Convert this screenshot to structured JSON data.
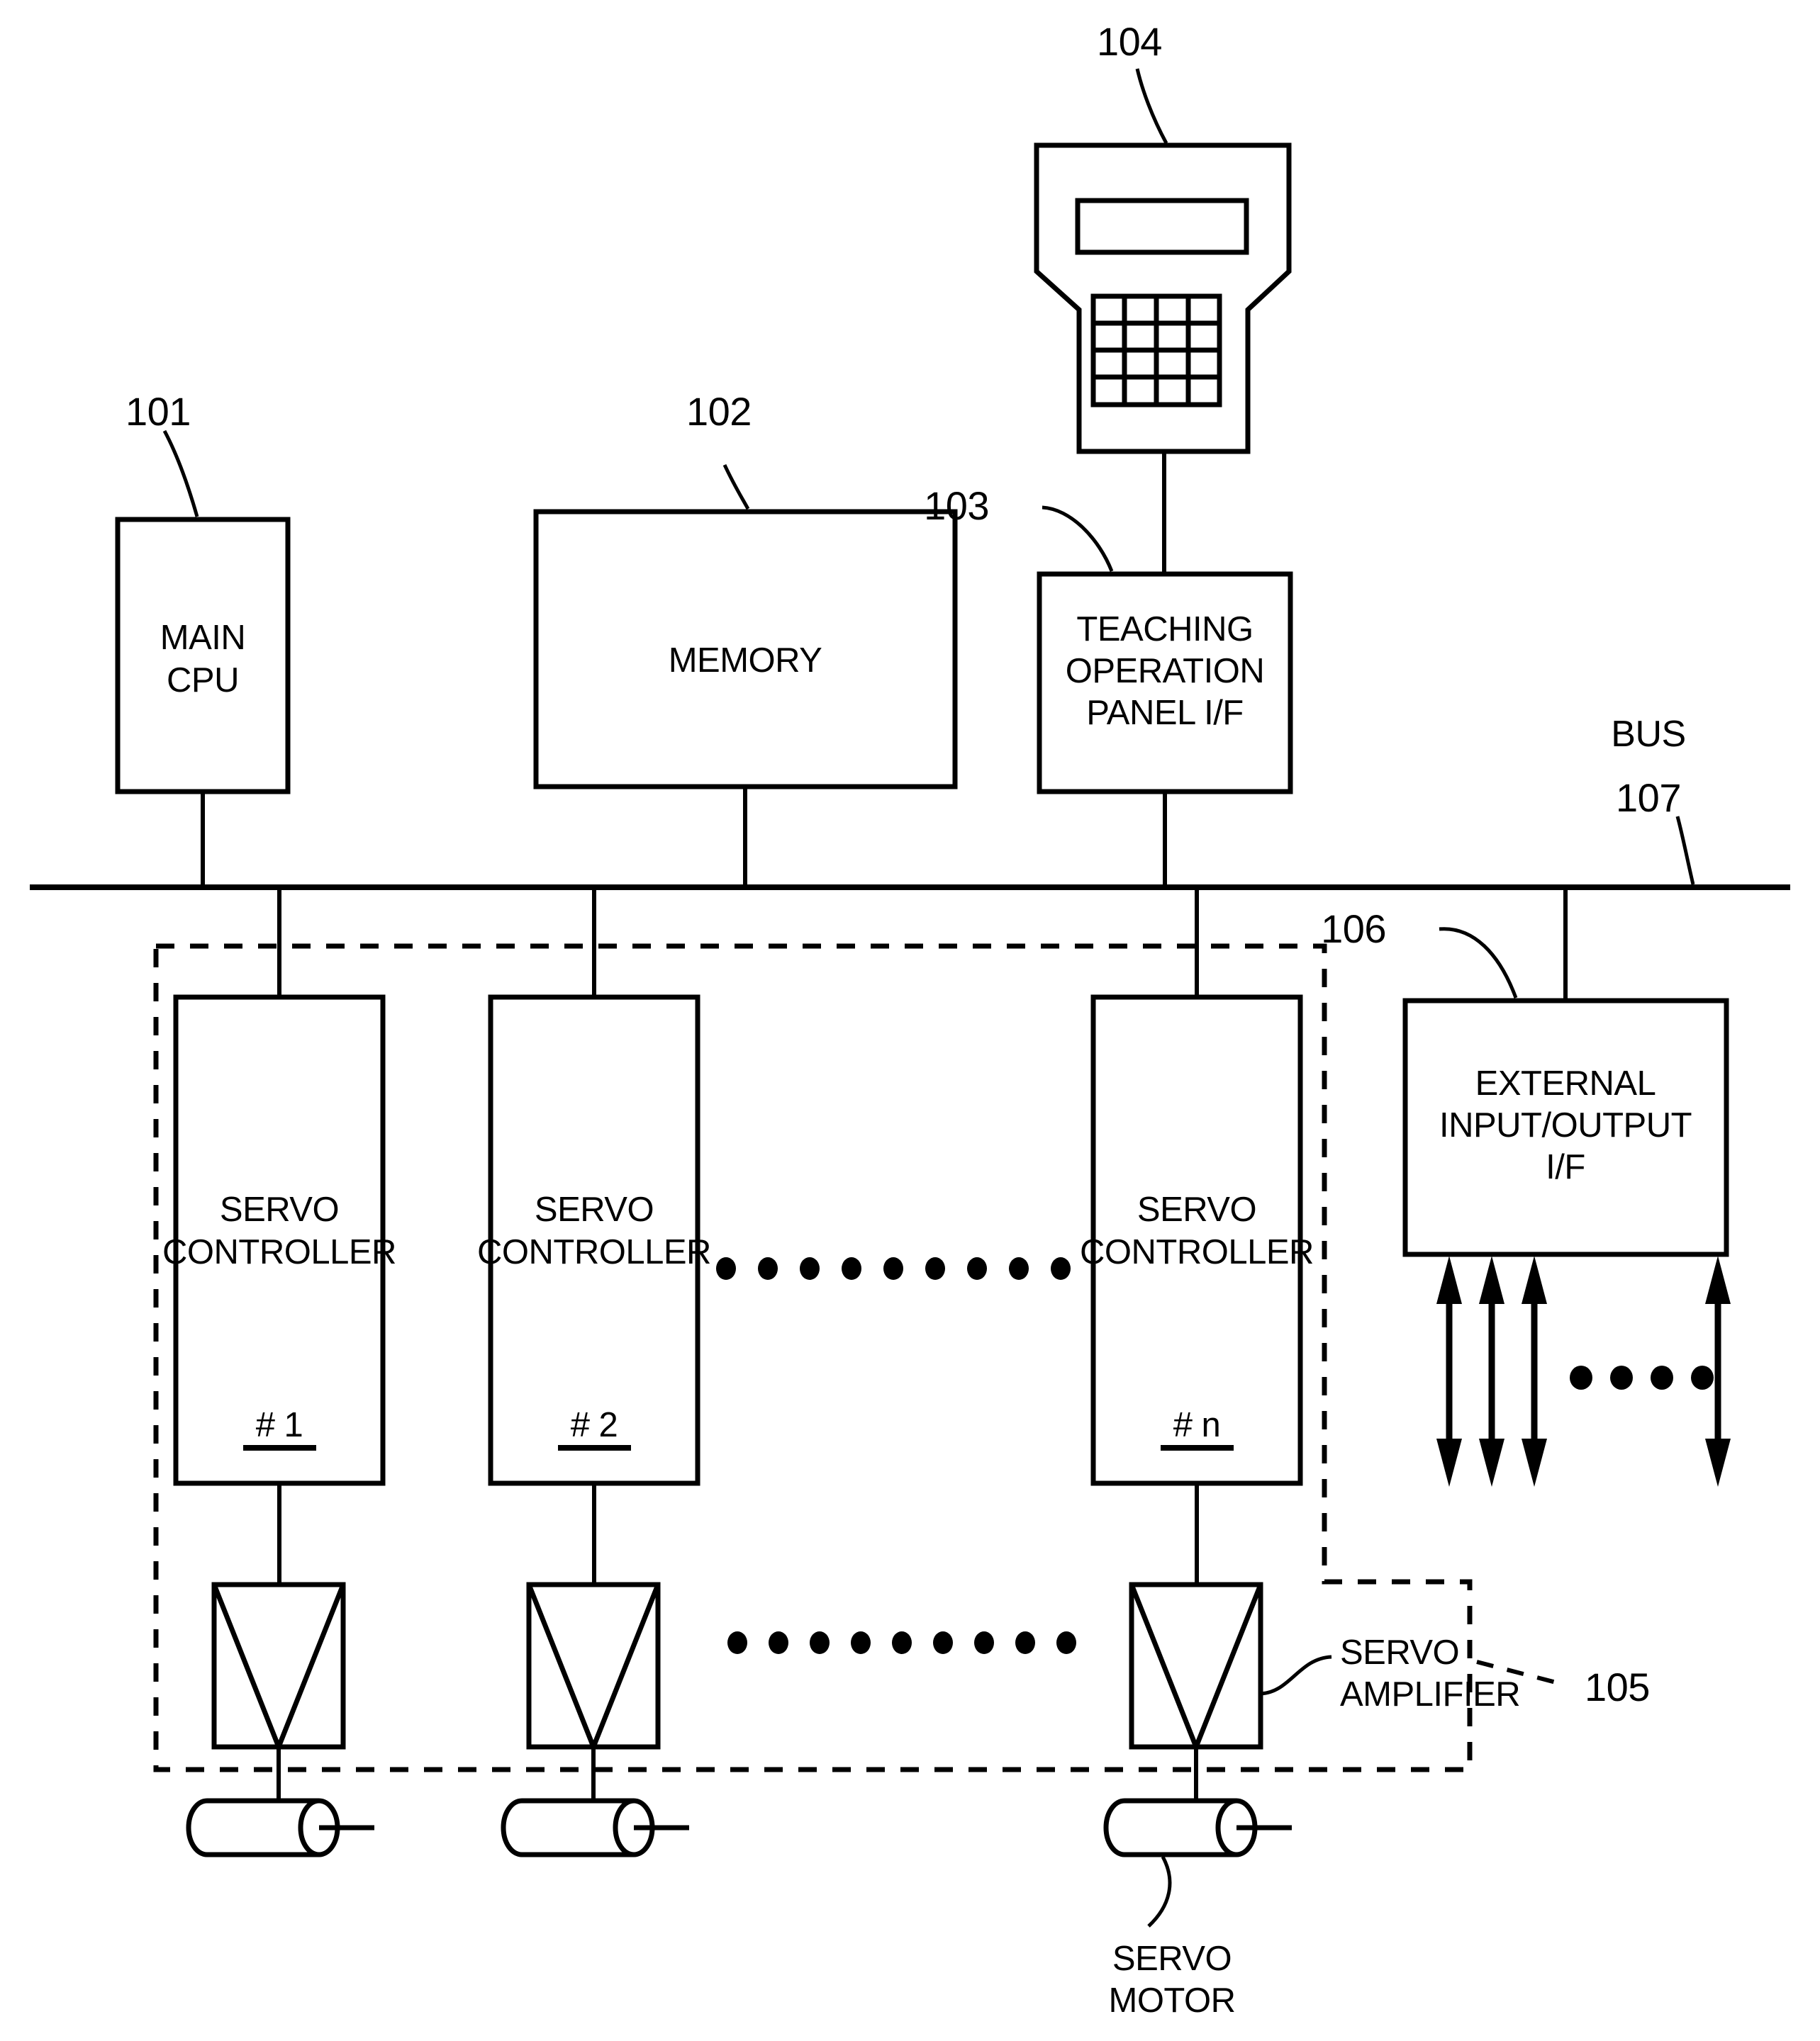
{
  "figure": {
    "type": "patent-block-diagram",
    "title": "Robot controller block diagram"
  },
  "blocks": {
    "main_cpu": {
      "label_line1": "MAIN",
      "label_line2": "CPU",
      "ref": "101"
    },
    "memory": {
      "label": "MEMORY",
      "ref": "102"
    },
    "teaching_panel_if": {
      "label_line1": "TEACHING",
      "label_line2": "OPERATION",
      "label_line3": "PANEL I/F",
      "ref": "103"
    },
    "teaching_pendant": {
      "ref": "104"
    },
    "external_io_if": {
      "label_line1": "EXTERNAL",
      "label_line2": "INPUT/OUTPUT",
      "label_line3": "I/F",
      "ref": "106"
    },
    "bus": {
      "label": "BUS",
      "ref": "107"
    },
    "servo_group": {
      "ref": "105"
    },
    "servo_amplifier": {
      "label_line1": "SERVO",
      "label_line2": "AMPLIFIER"
    },
    "servo_motor": {
      "label_line1": "SERVO",
      "label_line2": "MOTOR"
    }
  },
  "servo_controllers": [
    {
      "label_line1": "SERVO",
      "label_line2": "CONTROLLER",
      "index": "# 1"
    },
    {
      "label_line1": "SERVO",
      "label_line2": "CONTROLLER",
      "index": "# 2"
    },
    {
      "label_line1": "SERVO",
      "label_line2": "CONTROLLER",
      "index": "# n"
    }
  ],
  "ellipses": {
    "controller_row_dots": 9,
    "amplifier_row_dots": 9,
    "io_row_dots": 4
  },
  "io_arrows": {
    "count": 4,
    "type": "double-headed-vertical"
  },
  "colors": {
    "ink": "#000000",
    "paper": "#ffffff"
  }
}
